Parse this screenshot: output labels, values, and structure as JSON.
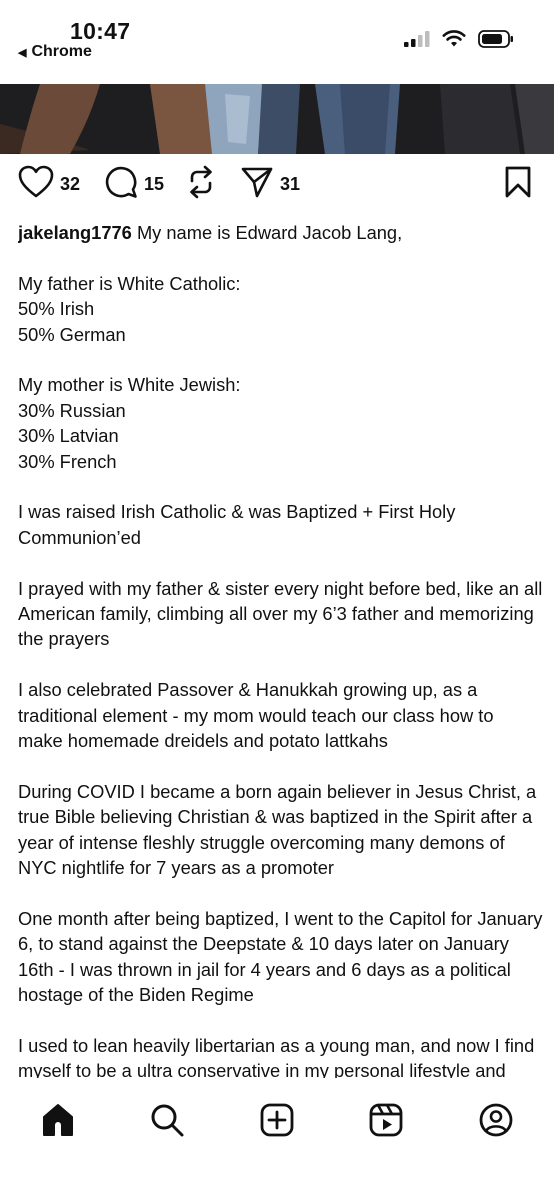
{
  "status_bar": {
    "time": "10:47",
    "back_app": "Chrome",
    "icons": [
      "cellular-signal-icon",
      "wifi-icon",
      "battery-icon"
    ]
  },
  "post": {
    "actions": {
      "likes": "32",
      "comments": "15",
      "reposts": "",
      "shares": "31"
    },
    "caption": {
      "username": "jakelang1776",
      "first_line": "My name is Edward Jacob Lang,",
      "paragraphs": [
        "My father is White Catholic:\n50% Irish\n50% German",
        "My mother is White Jewish:\n30% Russian\n30% Latvian\n30% French",
        "I was raised Irish Catholic & was Baptized + First Holy Communion’ed",
        "I prayed with my father & sister every night before bed, like an all American family, climbing all over my 6’3 father and memorizing the prayers",
        "I also celebrated Passover & Hanukkah growing up, as a traditional element - my mom would teach our class how to make homemade dreidels and potato lattkahs",
        "During COVID I became a born again believer in Jesus Christ, a true Bible believing Christian & was baptized in the Spirit after a year of intense fleshly struggle overcoming many demons of NYC nightlife for 7 years as a promoter",
        "One month after being baptized, I went to the Capitol for January 6, to stand against the Deepstate & 10 days later on January 16th - I was thrown in jail for 4 years and 6 days as a political hostage of the Biden Regime",
        "I used to lean heavily libertarian as a young man, and now I find myself to be a ultra conservative in my personal lifestyle and beliefs - but still believe in the"
      ]
    }
  },
  "bottom_nav": {
    "items": [
      "home-icon",
      "search-icon",
      "create-icon",
      "reels-icon",
      "profile-icon"
    ],
    "active": "home-icon"
  }
}
